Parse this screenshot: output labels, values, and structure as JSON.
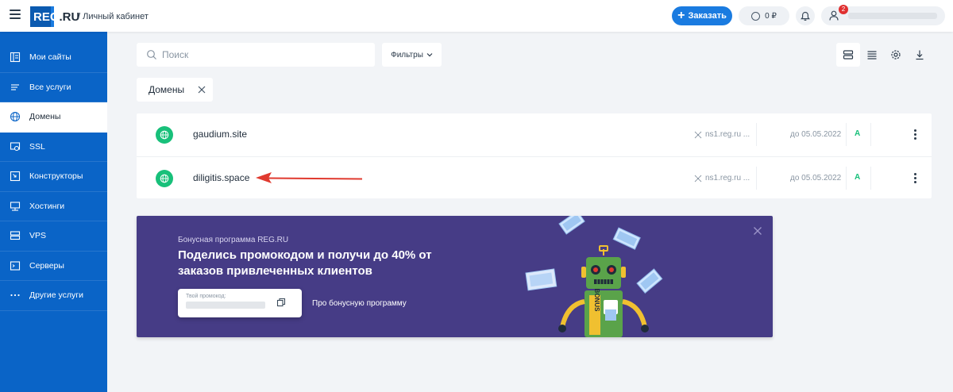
{
  "header": {
    "logo_main": "REG",
    "logo_dot": ".RU",
    "breadcrumb": "/ Личный кабинет",
    "order_label": "Заказать",
    "balance": "0 ₽",
    "notification_count": "2"
  },
  "sidebar": {
    "items": [
      {
        "label": "Мои сайты",
        "icon": "sites-icon"
      },
      {
        "label": "Все услуги",
        "icon": "list-icon"
      },
      {
        "label": "Домены",
        "icon": "globe-icon",
        "active": true
      },
      {
        "label": "SSL",
        "icon": "ssl-icon"
      },
      {
        "label": "Конструкторы",
        "icon": "builder-icon"
      },
      {
        "label": "Хостинги",
        "icon": "hosting-icon"
      },
      {
        "label": "VPS",
        "icon": "vps-icon"
      },
      {
        "label": "Серверы",
        "icon": "server-icon"
      },
      {
        "label": "Другие услуги",
        "icon": "more-icon"
      }
    ]
  },
  "toolbar": {
    "search_placeholder": "Поиск",
    "filters_label": "Фильтры"
  },
  "chip": {
    "label": "Домены"
  },
  "domains": [
    {
      "name": "gaudium.site",
      "ns": "ns1.reg.ru ...",
      "expires": "до 05.05.2022",
      "status": "A"
    },
    {
      "name": "diligitis.space",
      "ns": "ns1.reg.ru ...",
      "expires": "до 05.05.2022",
      "status": "A"
    }
  ],
  "banner": {
    "subtitle": "Бонусная программа REG.RU",
    "title": "Поделись промокодом и получи до 40% от заказов привлеченных клиентов",
    "promo_label": "Твой промокод:",
    "link": "Про бонусную программу",
    "robot_text": "BONUS"
  },
  "colors": {
    "sidebar": "#0a64c7",
    "accent": "#1a7be0",
    "success": "#18c07a",
    "banner": "#463c86",
    "annotation_arrow": "#e03a2f"
  }
}
